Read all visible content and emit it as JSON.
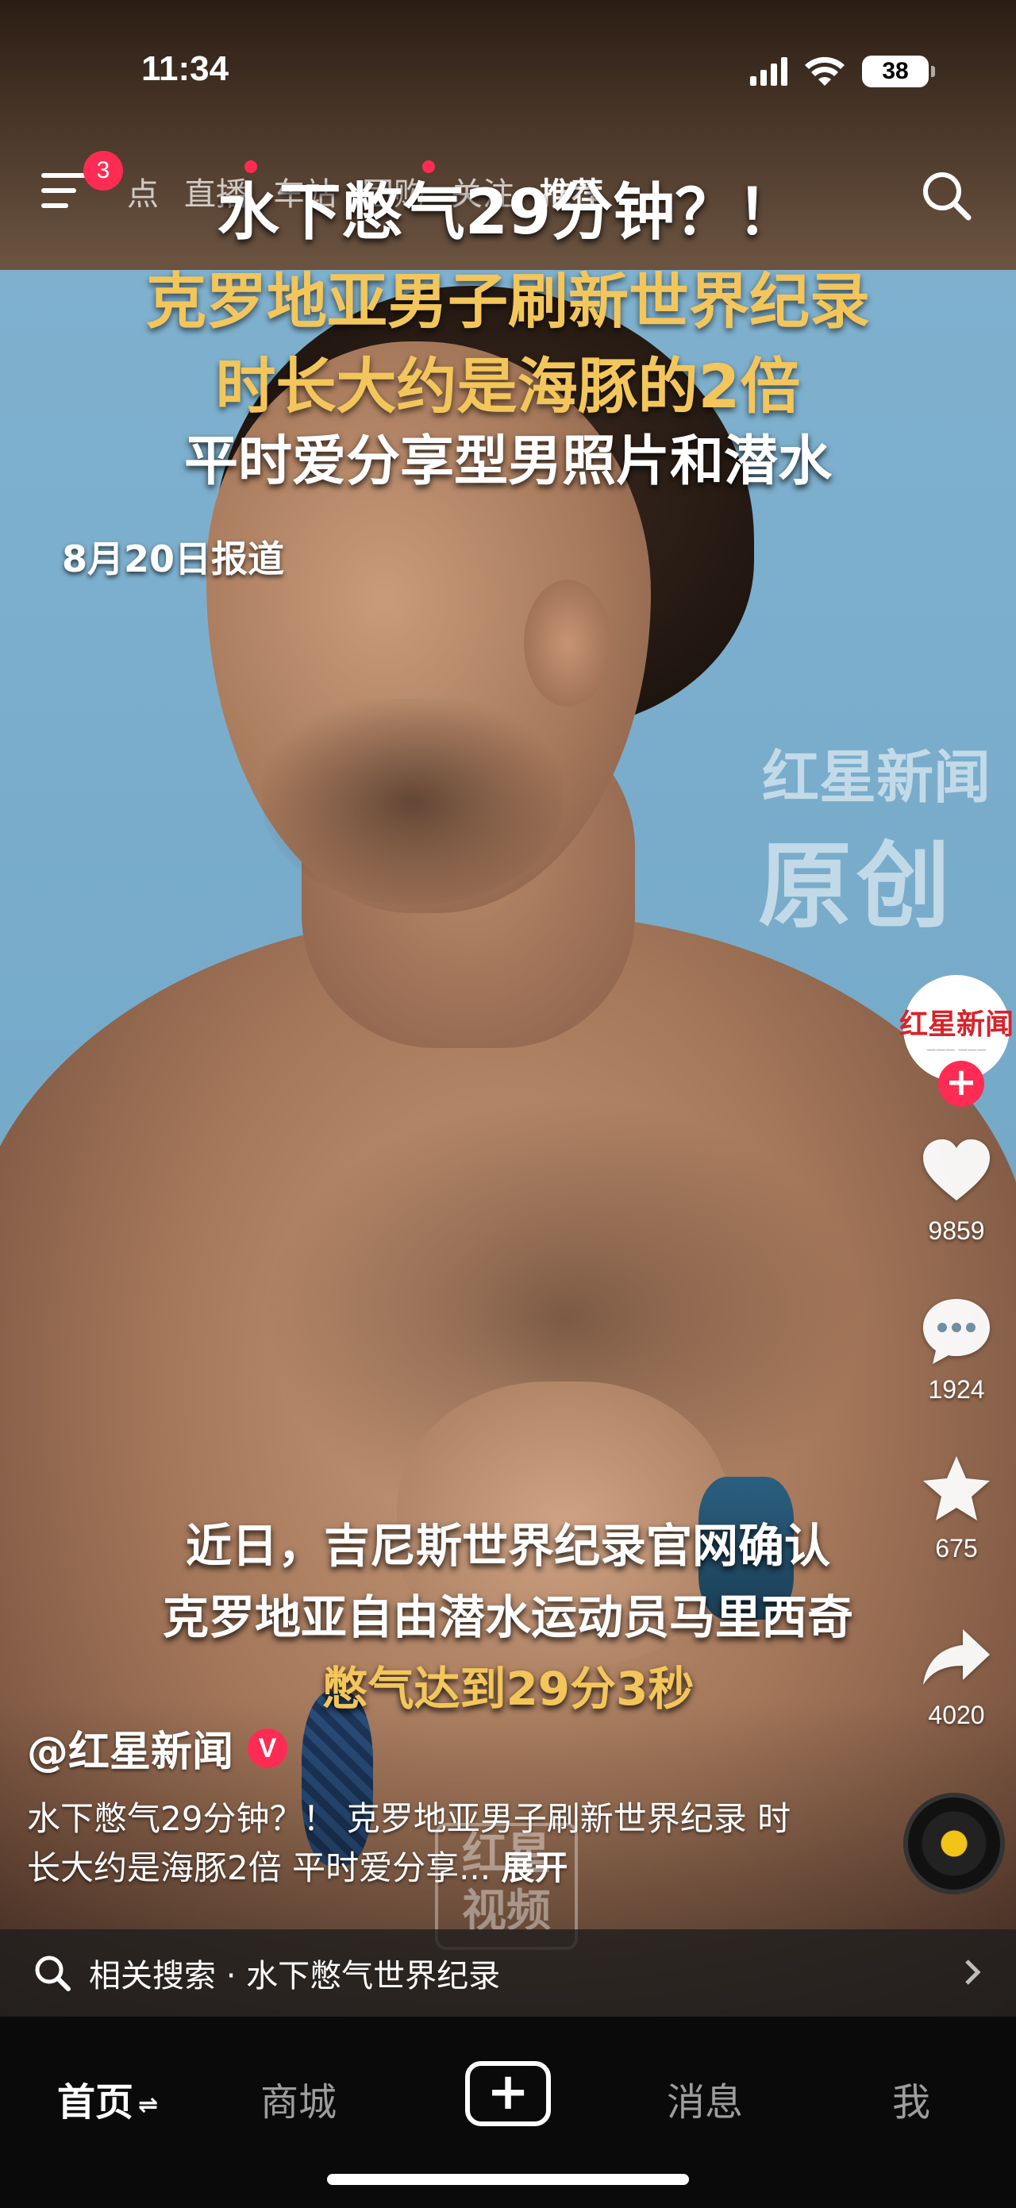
{
  "status_bar": {
    "time": "11:34",
    "battery": "38"
  },
  "top_nav": {
    "menu_badge": "3",
    "tabs": [
      {
        "label": "点"
      },
      {
        "label": "直播"
      },
      {
        "label": "车站"
      },
      {
        "label": "团购"
      },
      {
        "label": "关注"
      },
      {
        "label": "推荐",
        "active": true
      }
    ],
    "search_icon": "search-icon"
  },
  "video": {
    "headline_1": "水下憋气29分钟？！",
    "headline_2": "克罗地亚男子刷新世界纪录",
    "headline_3": "时长大约是海豚的2倍",
    "headline_4": "平时爱分享型男照片和潜水",
    "date_tag": "8月20日报道",
    "watermark_brand": "红星新闻",
    "watermark_original": "原创",
    "caption_1": "近日，吉尼斯世界纪录官网确认",
    "caption_2": "克罗地亚自由潜水运动员马里西奇",
    "caption_3": "憋气达到29分3秒",
    "bottom_watermark_1": "红星",
    "bottom_watermark_2": "视频"
  },
  "rail": {
    "avatar_brand": "红星新闻",
    "follow": "+",
    "likes": "9859",
    "comments": "1924",
    "favorites": "675",
    "shares": "4020"
  },
  "post": {
    "author": "@红星新闻",
    "verified": "V",
    "description": "水下憋气29分钟？！ 克罗地亚男子刷新世界纪录 时长大约是海豚2倍 平时爱分享...",
    "more": "展开"
  },
  "related_search": {
    "text": "相关搜索 · 水下憋气世界纪录"
  },
  "tab_bar": {
    "home": "首页",
    "mall": "商城",
    "create": "+",
    "messages": "消息",
    "me": "我"
  },
  "colors": {
    "accent": "#fe2c55",
    "highlight_text": "#f3c65b"
  }
}
